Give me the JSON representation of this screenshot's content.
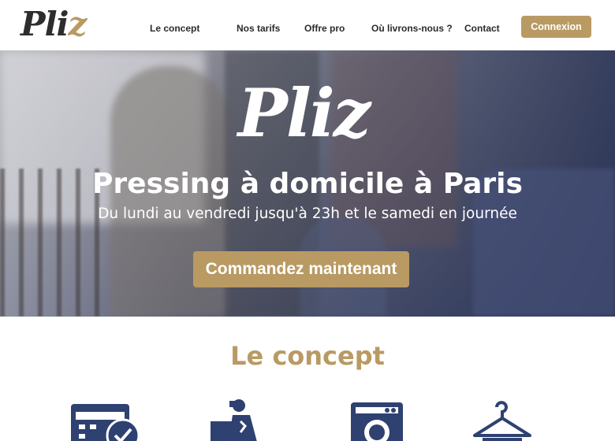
{
  "brand": {
    "logo_text": "Pliz",
    "accent_color": "#b99a63",
    "text_color": "#2b2b2b",
    "hero_overlay_color": "#3c4160"
  },
  "header": {
    "nav": [
      {
        "label": "Le concept"
      },
      {
        "label": "Nos tarifs"
      },
      {
        "label": "Offre pro"
      },
      {
        "label": "Où livrons-nous ?"
      },
      {
        "label": "Contact"
      }
    ],
    "login_label": "Connexion"
  },
  "hero": {
    "logo_text": "Pliz",
    "title": "Pressing à domicile à Paris",
    "subtitle": "Du lundi au vendredi jusqu'à 23h et le samedi en journée",
    "cta_label": "Commandez maintenant"
  },
  "concept": {
    "title": "Le concept",
    "icons": [
      {
        "name": "calendar-check-icon"
      },
      {
        "name": "delivery-person-icon"
      },
      {
        "name": "washing-machine-icon"
      },
      {
        "name": "clothes-hanger-icon"
      }
    ]
  }
}
